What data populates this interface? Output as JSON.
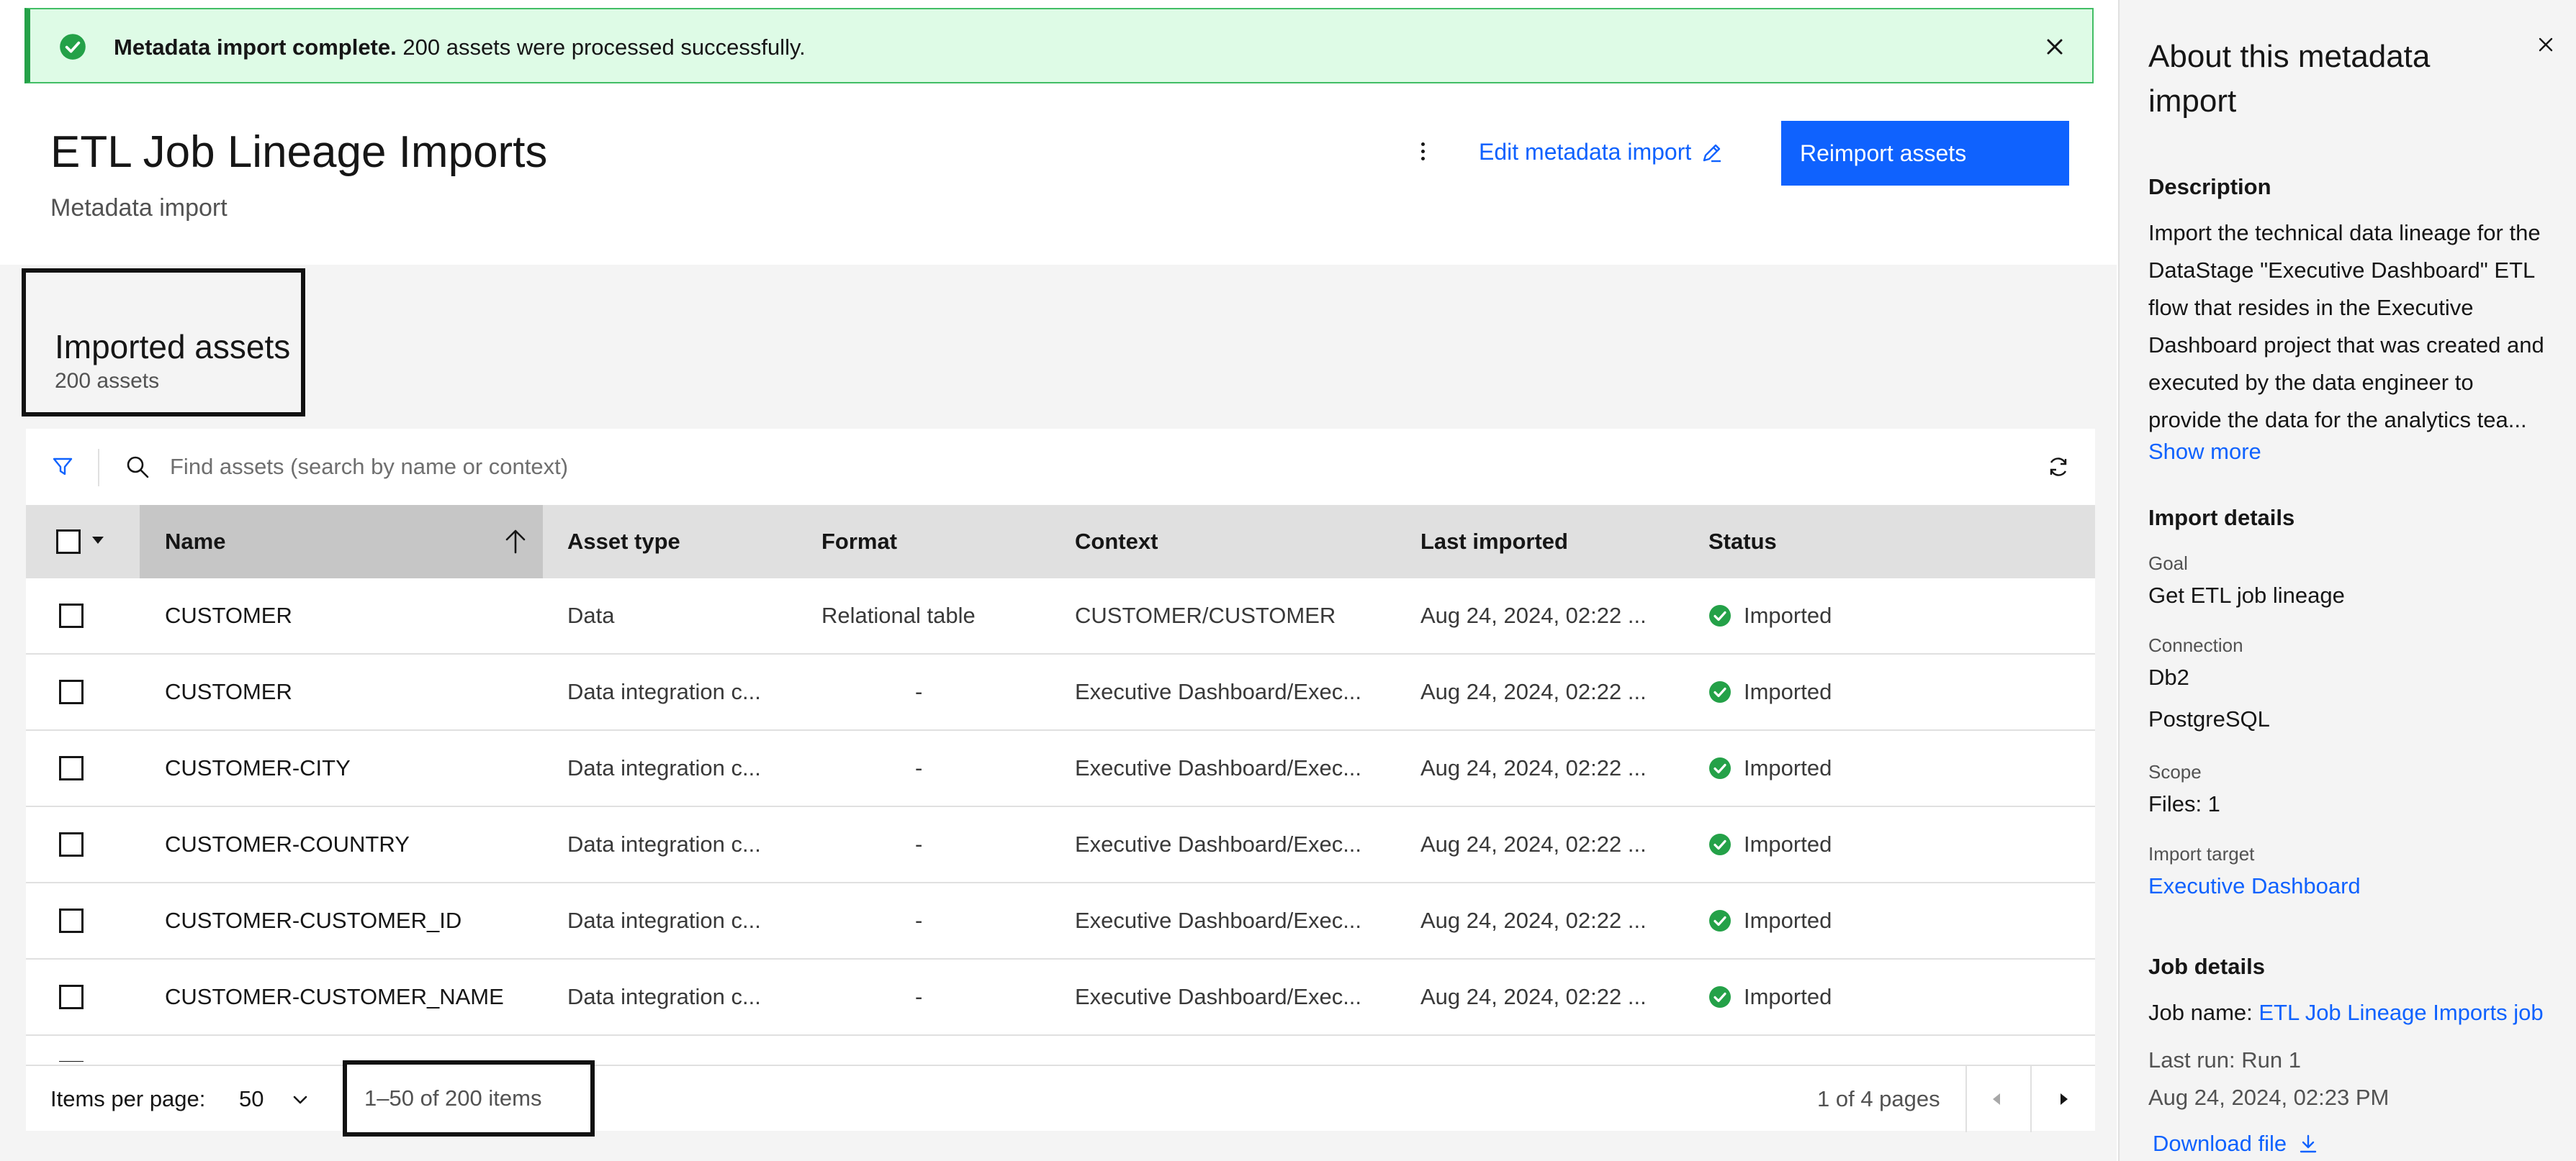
{
  "banner": {
    "title": "Metadata import complete.",
    "message": " 200 assets were processed successfully."
  },
  "header": {
    "title": "ETL Job Lineage Imports",
    "subtitle": "Metadata import",
    "edit_link": "Edit metadata import",
    "primary_button": "Reimport assets"
  },
  "assets": {
    "heading": "Imported assets",
    "count": "200 assets"
  },
  "search": {
    "placeholder": "Find assets (search by name or context)"
  },
  "table": {
    "columns": [
      "Name",
      "Asset type",
      "Format",
      "Context",
      "Last imported",
      "Status"
    ],
    "rows": [
      [
        "CUSTOMER",
        "Data",
        "Relational table",
        "CUSTOMER/CUSTOMER",
        "Aug 24, 2024, 02:22 ...",
        "Imported"
      ],
      [
        "CUSTOMER",
        "Data integration c...",
        "-",
        "Executive Dashboard/Exec...",
        "Aug 24, 2024, 02:22 ...",
        "Imported"
      ],
      [
        "CUSTOMER-CITY",
        "Data integration c...",
        "-",
        "Executive Dashboard/Exec...",
        "Aug 24, 2024, 02:22 ...",
        "Imported"
      ],
      [
        "CUSTOMER-COUNTRY",
        "Data integration c...",
        "-",
        "Executive Dashboard/Exec...",
        "Aug 24, 2024, 02:22 ...",
        "Imported"
      ],
      [
        "CUSTOMER-CUSTOMER_ID",
        "Data integration c...",
        "-",
        "Executive Dashboard/Exec...",
        "Aug 24, 2024, 02:22 ...",
        "Imported"
      ],
      [
        "CUSTOMER-CUSTOMER_NAME",
        "Data integration c...",
        "-",
        "Executive Dashboard/Exec...",
        "Aug 24, 2024, 02:22 ...",
        "Imported"
      ]
    ]
  },
  "pagination": {
    "items_per_page_label": "Items per page:",
    "items_per_page_value": "50",
    "range": "1–50 of 200 items",
    "pages": "1 of 4 pages"
  },
  "side_panel": {
    "title": "About this metadata import",
    "description_heading": "Description",
    "description": "Import the technical data lineage for the DataStage \"Executive Dashboard\" ETL flow that resides in the Executive Dashboard project that was created and executed by the data engineer to provide the data for the analytics tea...",
    "show_more": "Show more",
    "import_details_heading": "Import details",
    "goal_label": "Goal",
    "goal_value": "Get ETL job lineage",
    "connection_label": "Connection",
    "connection_values": [
      "Db2",
      "PostgreSQL"
    ],
    "scope_label": "Scope",
    "scope_value": "Files: 1",
    "target_label": "Import target",
    "target_value": "Executive Dashboard",
    "job_details_heading": "Job details",
    "job_name_label": "Job name: ",
    "job_name_value": "ETL Job Lineage Imports job",
    "last_run": "Last run: Run 1",
    "last_run_time": "Aug 24, 2024, 02:23 PM",
    "download": "Download file"
  },
  "colors": {
    "accent": "#0f62fe",
    "success": "#24a148",
    "banner_bg": "#defbe6"
  }
}
